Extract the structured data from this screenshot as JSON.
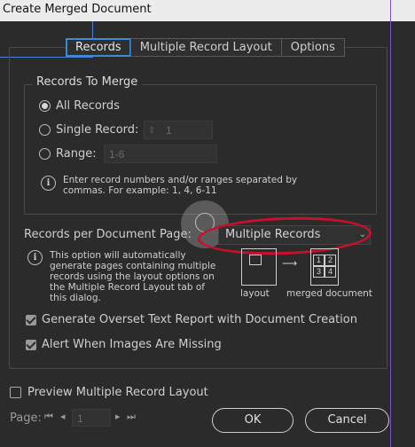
{
  "window": {
    "title": "Create Merged Document"
  },
  "tabs": [
    {
      "label": "Records"
    },
    {
      "label": "Multiple Record Layout"
    },
    {
      "label": "Options"
    }
  ],
  "records_group": {
    "title": "Records To Merge",
    "all_records": "All Records",
    "single_record": "Single Record:",
    "single_record_value": "1",
    "range": "Range:",
    "range_placeholder": "1-6",
    "info_text": [
      "Enter record numbers and/or ranges separated by",
      "commas. For example: 1, 4, 6-11"
    ]
  },
  "per_page": {
    "label": "Records per Document Page:",
    "selected": "Multiple Records",
    "info_text": [
      "This option will automatically",
      "generate pages containing multiple",
      "records using the layout options on",
      "the Multiple Record Layout tab of",
      "this dialog."
    ],
    "diagram": {
      "layout_label": "layout",
      "merged_label": "merged document",
      "cells": [
        "1",
        "2",
        "3",
        "4"
      ]
    }
  },
  "checkboxes": {
    "overset": "Generate Overset Text Report with Document Creation",
    "alert_images": "Alert When Images Are Missing",
    "preview": "Preview Multiple Record Layout"
  },
  "pager": {
    "label": "Page:",
    "value": "1"
  },
  "buttons": {
    "ok": "OK",
    "cancel": "Cancel"
  }
}
